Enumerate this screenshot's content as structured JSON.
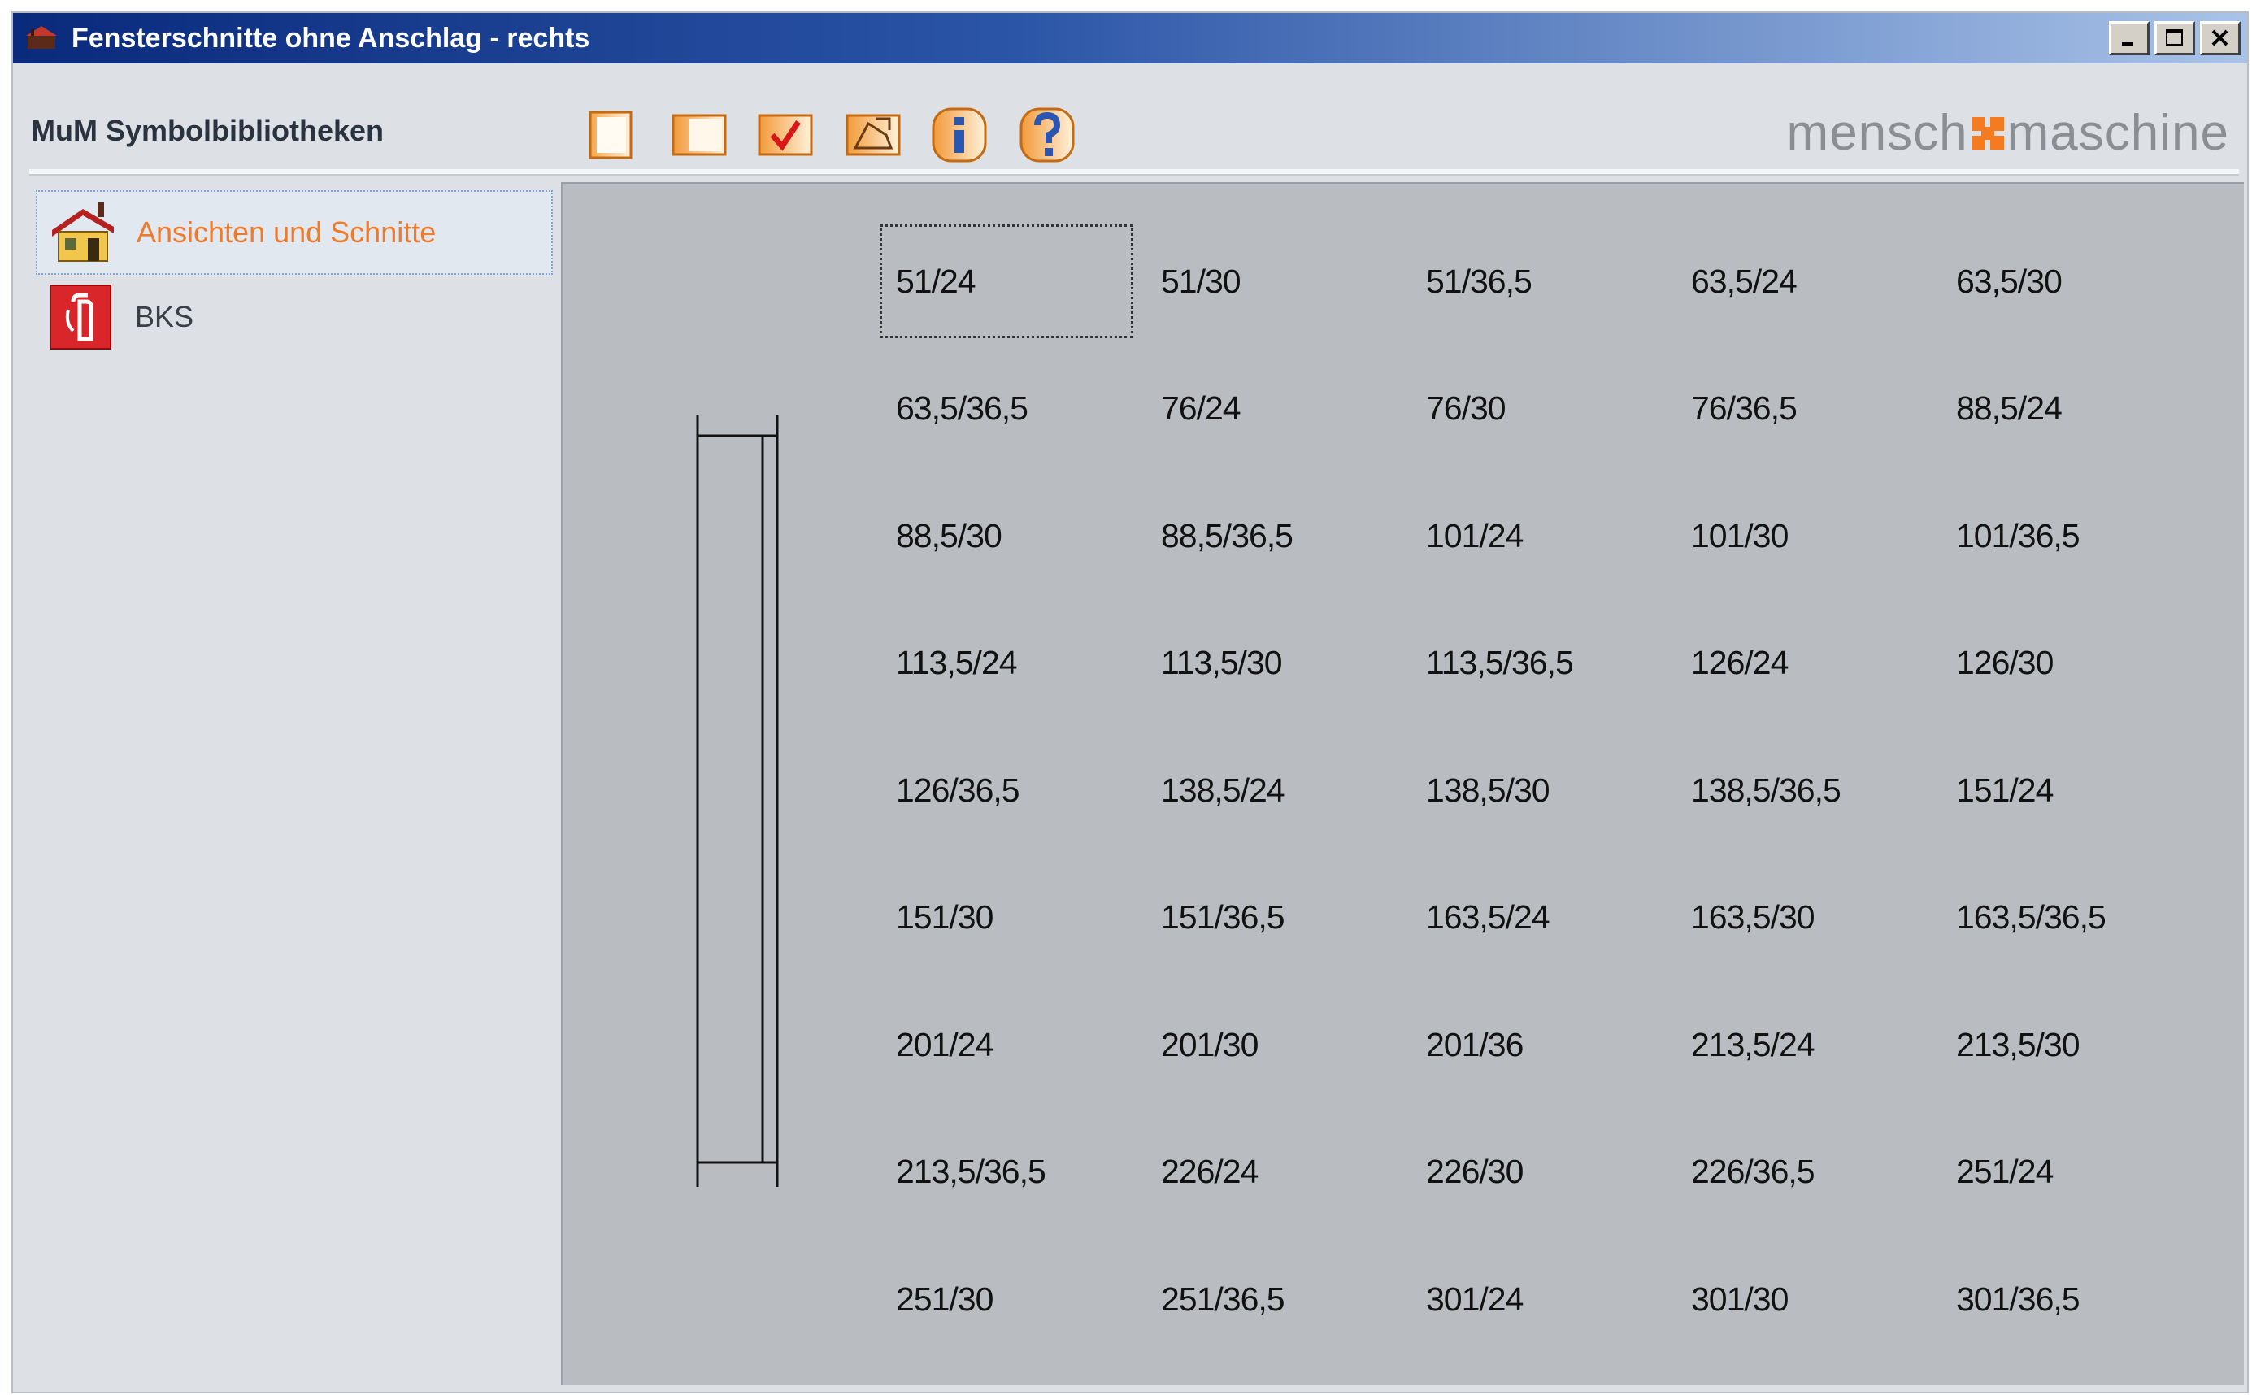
{
  "window": {
    "title": "Fensterschnitte ohne Anschlag - rechts",
    "controls": [
      "minimize",
      "maximize",
      "close"
    ]
  },
  "toolbar": {
    "library_title": "MuM Symbolbibliotheken",
    "buttons": [
      {
        "icon": "blank-page-icon"
      },
      {
        "icon": "panel-page-icon"
      },
      {
        "icon": "checkmark-icon"
      },
      {
        "icon": "insert-symbol-icon"
      },
      {
        "icon": "info-icon"
      },
      {
        "icon": "help-icon"
      }
    ],
    "logo": {
      "left": "mensch",
      "right": "maschine",
      "accent_color": "#f47b20"
    }
  },
  "sidebar": {
    "items": [
      {
        "label": "Ansichten und Schnitte",
        "icon": "house-icon",
        "selected": true,
        "color": "#f07a2a"
      },
      {
        "label": "BKS",
        "icon": "fire-extinguisher-sign-icon",
        "selected": false,
        "color": "#3a3f46"
      }
    ]
  },
  "symbols": [
    "51/24",
    "51/30",
    "51/36,5",
    "63,5/24",
    "63,5/30",
    "63,5/36,5",
    "76/24",
    "76/30",
    "76/36,5",
    "88,5/24",
    "88,5/30",
    "88,5/36,5",
    "101/24",
    "101/30",
    "101/36,5",
    "113,5/24",
    "113,5/30",
    "113,5/36,5",
    "126/24",
    "126/30",
    "126/36,5",
    "138,5/24",
    "138,5/30",
    "138,5/36,5",
    "151/24",
    "151/30",
    "151/36,5",
    "163,5/24",
    "163,5/30",
    "163,5/36,5",
    "201/24",
    "201/30",
    "201/36",
    "213,5/24",
    "213,5/30",
    "213,5/36,5",
    "226/24",
    "226/30",
    "226/36,5",
    "251/24",
    "251/30",
    "251/36,5",
    "301/24",
    "301/30",
    "301/36,5"
  ],
  "focused_symbol_index": 0
}
